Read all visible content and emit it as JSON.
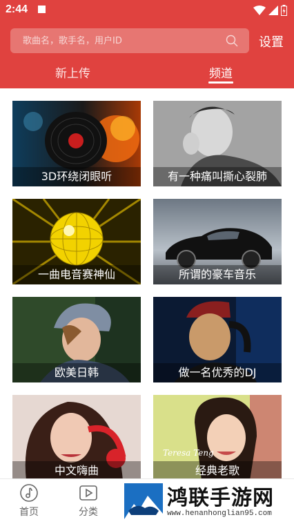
{
  "status_bar": {
    "time": "2:44"
  },
  "header": {
    "search_placeholder": "歌曲名，歌手名，用户ID",
    "settings_label": "设置",
    "tabs": [
      {
        "label": "新上传",
        "selected": false
      },
      {
        "label": "频道",
        "selected": true
      }
    ],
    "accent_color": "#e0423f"
  },
  "channels": [
    {
      "label": "3D环绕闭眼听"
    },
    {
      "label": "有一种痛叫撕心裂肺"
    },
    {
      "label": "一曲电音赛神仙"
    },
    {
      "label": "所谓的豪车音乐"
    },
    {
      "label": "欧美日韩"
    },
    {
      "label": "做一名优秀的DJ"
    },
    {
      "label": "中文嗨曲"
    },
    {
      "label": "经典老歌"
    }
  ],
  "bottom_nav": {
    "items": [
      {
        "label": "首页",
        "icon": "music-note-icon"
      },
      {
        "label": "分类",
        "icon": "play-box-icon"
      }
    ]
  },
  "watermark": {
    "title": "鸿联手游网",
    "url": "www.henanhonglian95.com"
  }
}
